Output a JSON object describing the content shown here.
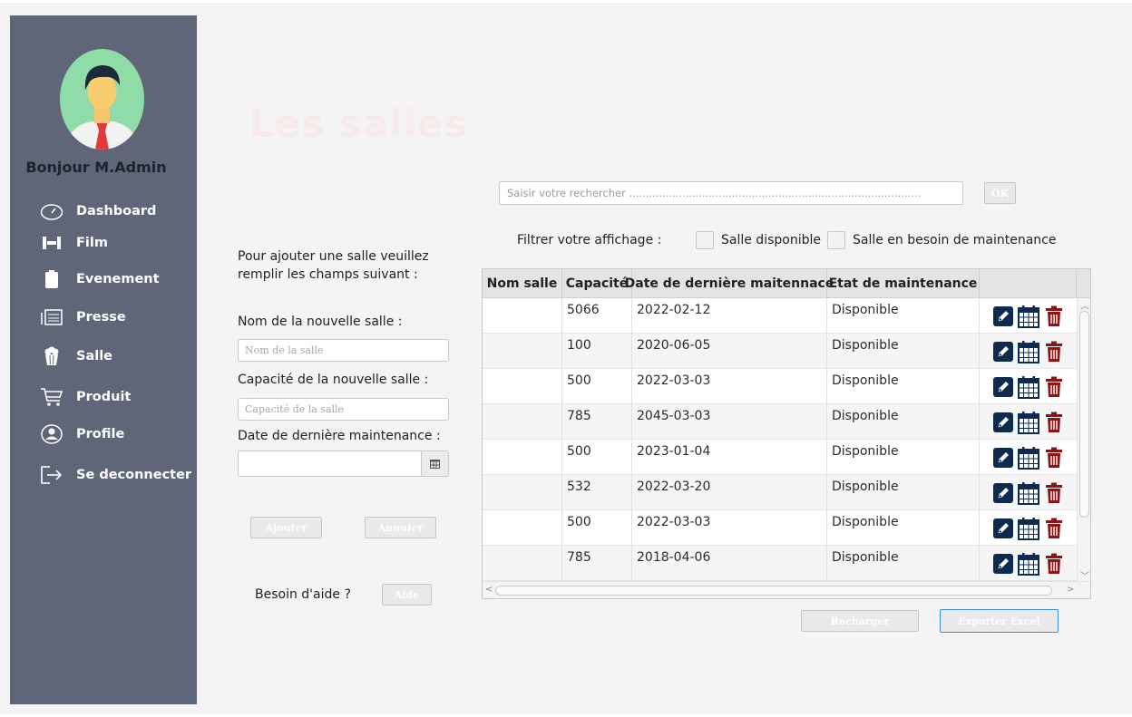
{
  "sidebar": {
    "greeting": "Bonjour M.Admin",
    "items": [
      {
        "label": "Dashboard",
        "icon": "dashboard-gauge-icon"
      },
      {
        "label": "Film",
        "icon": "film-icon"
      },
      {
        "label": "Evenement",
        "icon": "clipboard-icon"
      },
      {
        "label": "Presse",
        "icon": "newspaper-icon"
      },
      {
        "label": "Salle",
        "icon": "popcorn-icon"
      },
      {
        "label": "Produit",
        "icon": "cart-icon"
      },
      {
        "label": "Profile",
        "icon": "user-circle-icon"
      },
      {
        "label": "Se deconnecter",
        "icon": "logout-icon"
      }
    ]
  },
  "page": {
    "title": "Les salles"
  },
  "search": {
    "placeholder": "Saisir votre rechercher ........................................................................................",
    "ok_label": "OK"
  },
  "filter": {
    "label": "Filtrer votre affichage :",
    "option1": "Salle disponible",
    "option2": "Salle en besoin de maintenance"
  },
  "form": {
    "intro": "Pour ajouter une salle veuillez remplir les champs suivant :",
    "name_label": "Nom de la nouvelle salle :",
    "name_placeholder": "Nom de la salle",
    "capacity_label": "Capacité de la nouvelle salle :",
    "capacity_placeholder": "Capacité de la salle",
    "date_label": "Date de dernière maintenance :",
    "date_value": "",
    "add_label": "Ajouter",
    "cancel_label": "Annuler",
    "help_question": "Besoin d'aide ?",
    "help_label": "Aide"
  },
  "table": {
    "columns": [
      "Nom salle",
      "Capacité",
      "Date de dernière maitennace",
      "Etat de maintenance",
      ""
    ],
    "rows": [
      {
        "nom": "",
        "capacite": "5066",
        "date": "2022-02-12",
        "etat": "Disponible"
      },
      {
        "nom": "",
        "capacite": "100",
        "date": "2020-06-05",
        "etat": "Disponible"
      },
      {
        "nom": "",
        "capacite": "500",
        "date": "2022-03-03",
        "etat": "Disponible"
      },
      {
        "nom": "",
        "capacite": "785",
        "date": "2045-03-03",
        "etat": "Disponible"
      },
      {
        "nom": "",
        "capacite": "500",
        "date": "2023-01-04",
        "etat": "Disponible"
      },
      {
        "nom": "",
        "capacite": "532",
        "date": "2022-03-20",
        "etat": "Disponible"
      },
      {
        "nom": "",
        "capacite": "500",
        "date": "2022-03-03",
        "etat": "Disponible"
      },
      {
        "nom": "",
        "capacite": "785",
        "date": "2018-04-06",
        "etat": "Disponible"
      }
    ],
    "row_actions": [
      "edit-pencil-icon",
      "calendar-icon",
      "trash-icon"
    ]
  },
  "footer": {
    "reload_label": "Recharger",
    "export_label": "Exporter Excel"
  },
  "colors": {
    "sidebar": "#5e6678",
    "edit": "#0d2a4f",
    "calendar": "#0d2a4f",
    "trash": "#8b1414",
    "avatar_bg": "#8fdca8"
  }
}
